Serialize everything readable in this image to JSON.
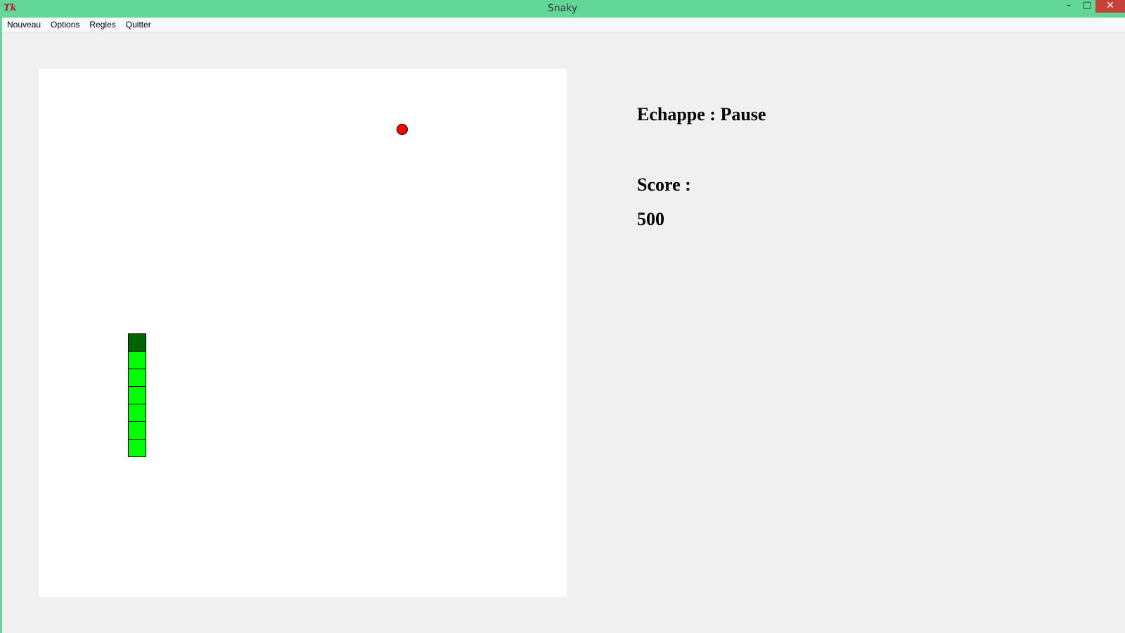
{
  "window": {
    "title": "Snaky",
    "icon": "Tk",
    "controls": {
      "minimize": "–",
      "maximize": "□",
      "close": "✕"
    }
  },
  "menu": {
    "items": [
      "Nouveau",
      "Options",
      "Regles",
      "Quitter"
    ]
  },
  "board": {
    "grid_cols": 30,
    "grid_rows": 30,
    "snake_color": "#00ff00",
    "snake_head_color": "#006400",
    "food_color": "#ff0000",
    "snake": [
      {
        "col": 5,
        "row": 15
      },
      {
        "col": 5,
        "row": 16
      },
      {
        "col": 5,
        "row": 17
      },
      {
        "col": 5,
        "row": 18
      },
      {
        "col": 5,
        "row": 19
      },
      {
        "col": 5,
        "row": 20
      },
      {
        "col": 5,
        "row": 21
      }
    ],
    "food": {
      "col": 20,
      "row": 3
    }
  },
  "info": {
    "pause_hint": "Echappe : Pause",
    "score_label": "Score :",
    "score_value": "500"
  }
}
